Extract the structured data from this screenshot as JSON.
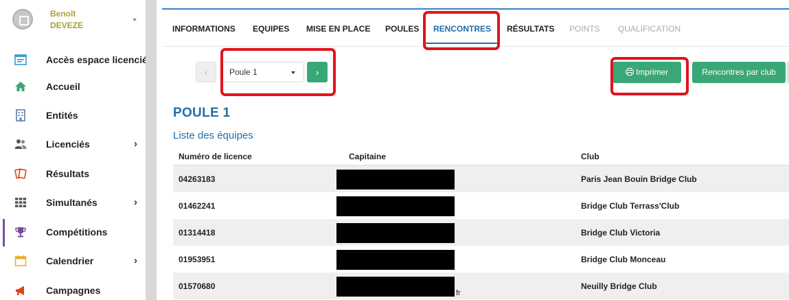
{
  "user": {
    "first_name": "Benoît",
    "last_name": "DEVEZE",
    "avatar_icon": "id-card-icon"
  },
  "sidebar": {
    "items": [
      {
        "label": "Accès espace licencié",
        "icon": "id-card-icon",
        "icon_color": "#3a9bd5"
      },
      {
        "label": "Accueil",
        "icon": "home-icon",
        "icon_color": "#3aa776"
      },
      {
        "label": "Entités",
        "icon": "building-icon",
        "icon_color": "#5b7fa6"
      },
      {
        "label": "Licenciés",
        "icon": "users-icon",
        "icon_color": "#555555",
        "has_submenu": true
      },
      {
        "label": "Résultats",
        "icon": "cards-icon",
        "icon_color": "#e0401a"
      },
      {
        "label": "Simultanés",
        "icon": "grid-icon",
        "icon_color": "#555555",
        "has_submenu": true
      },
      {
        "label": "Compétitions",
        "icon": "trophy-icon",
        "icon_color": "#7a4b9a",
        "active": true
      },
      {
        "label": "Calendrier",
        "icon": "calendar-icon",
        "icon_color": "#e8b030",
        "has_submenu": true
      },
      {
        "label": "Campagnes",
        "icon": "megaphone-icon",
        "icon_color": "#e0401a"
      }
    ],
    "chevron": "›"
  },
  "tabs": [
    {
      "label": "INFORMATIONS",
      "state": "normal"
    },
    {
      "label": "EQUIPES",
      "state": "normal"
    },
    {
      "label": "MISE EN PLACE",
      "state": "normal"
    },
    {
      "label": "POULES",
      "state": "normal"
    },
    {
      "label": "RENCONTRES",
      "state": "active"
    },
    {
      "label": "RÉSULTATS",
      "state": "normal"
    },
    {
      "label": "POINTS",
      "state": "disabled"
    },
    {
      "label": "QUALIFICATION",
      "state": "disabled"
    }
  ],
  "toolbar": {
    "prev_symbol": "‹",
    "next_symbol": "›",
    "poule_select": "Poule 1",
    "print_label": "Imprimer",
    "print_icon": "printer-icon",
    "club_button_label": "Rencontres par club"
  },
  "colors": {
    "accent_green": "#3aa776",
    "link_blue": "#1f6fa8",
    "highlight_red": "#e0141c"
  },
  "section": {
    "title": "POULE 1",
    "subtitle": "Liste des équipes"
  },
  "table": {
    "headers": {
      "licence": "Numéro de licence",
      "captain": "Capitaine",
      "club": "Club"
    },
    "rows": [
      {
        "licence": "04263183",
        "captain": "",
        "club": "Paris Jean Bouin Bridge Club"
      },
      {
        "licence": "01462241",
        "captain": "",
        "club": "Bridge Club Terrass'Club"
      },
      {
        "licence": "01314418",
        "captain": "",
        "club": "Bridge Club Victoria"
      },
      {
        "licence": "01953951",
        "captain": "",
        "club": "Bridge Club Monceau"
      },
      {
        "licence": "01570680",
        "captain": "",
        "club": "Neuilly Bridge Club"
      }
    ],
    "captain_tail_fragment": "fr"
  }
}
